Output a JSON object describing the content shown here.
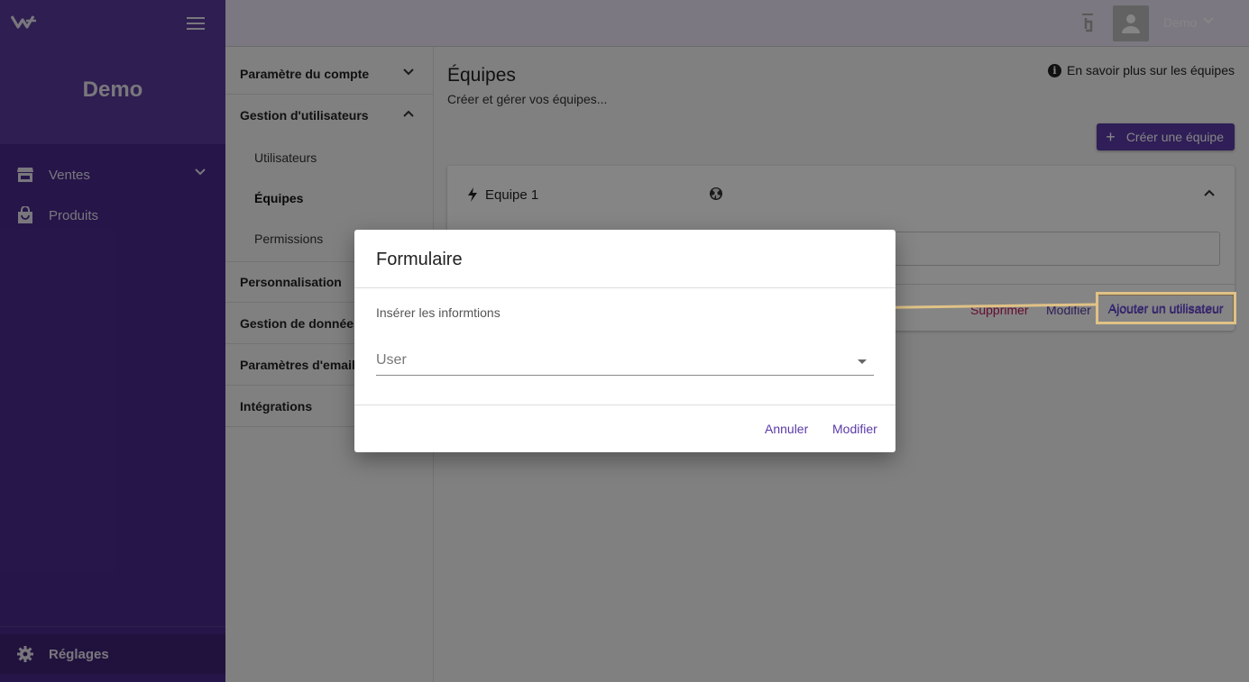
{
  "colors": {
    "sidebar": "#4a2a8c",
    "accent": "#5b3aa8",
    "danger": "#c2185b",
    "highlight": "#e0c287"
  },
  "sidebar": {
    "brand": "Demo",
    "items": [
      {
        "label": "Ventes",
        "icon": "store-icon"
      },
      {
        "label": "Produits",
        "icon": "shopping-bag-icon"
      }
    ],
    "settings_label": "Réglages"
  },
  "topbar": {
    "user_name": "Demo"
  },
  "submenu": {
    "account": "Paramètre du compte",
    "user_mgmt": "Gestion d'utilisateurs",
    "users": "Utilisateurs",
    "teams": "Équipes",
    "permissions": "Permissions",
    "customization": "Personnalisation",
    "data_mgmt": "Gestion de données",
    "email_settings": "Paramètres d'email",
    "integrations": "Intégrations"
  },
  "main": {
    "title": "Équipes",
    "subtitle": "Créer et gérer vos équipes...",
    "learn_more": "En savoir plus sur les équipes",
    "create_button": "Créer une équipe",
    "team": {
      "name": "Equipe 1",
      "delete": "Supprimer",
      "edit": "Modifier",
      "add_user": "Ajouter un utilisateur"
    }
  },
  "dialog": {
    "title": "Formulaire",
    "hint": "Insérer les informtions",
    "select_label": "User",
    "cancel": "Annuler",
    "confirm": "Modifier"
  }
}
